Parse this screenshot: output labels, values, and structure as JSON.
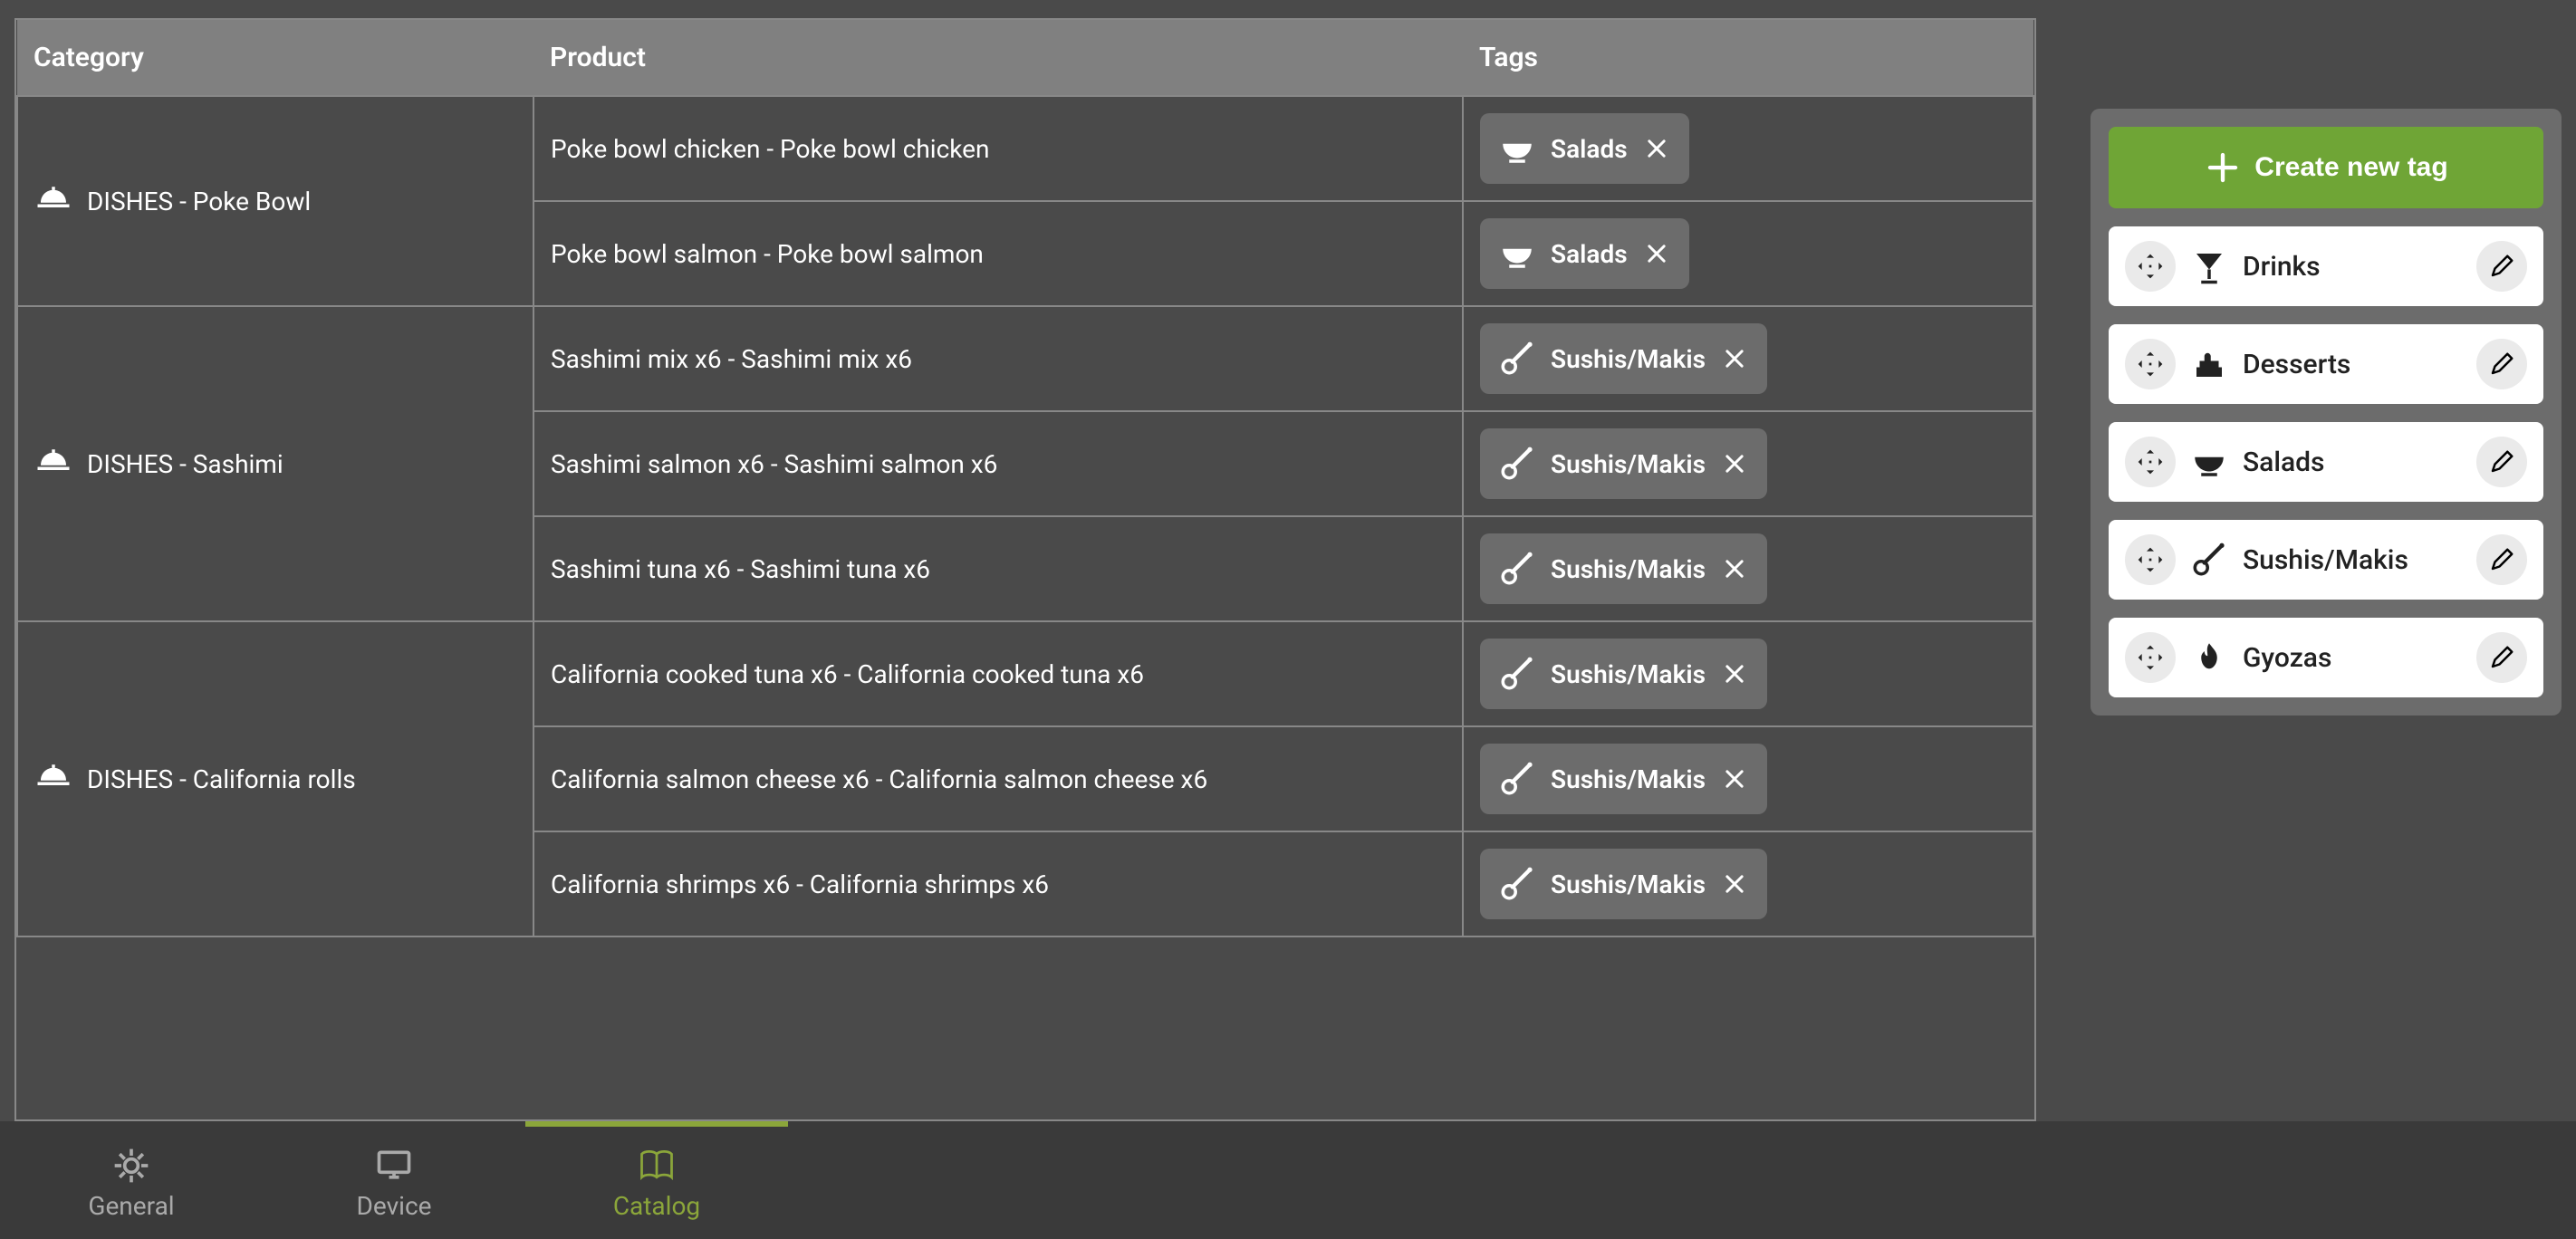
{
  "table": {
    "headers": {
      "category": "Category",
      "product": "Product",
      "tags": "Tags"
    },
    "groups": [
      {
        "category": "DISHES - Poke Bowl",
        "icon": "dish",
        "rows": [
          {
            "product": "Poke bowl chicken - Poke bowl chicken",
            "tag": {
              "label": "Salads",
              "icon": "bowl"
            }
          },
          {
            "product": "Poke bowl salmon - Poke bowl salmon",
            "tag": {
              "label": "Salads",
              "icon": "bowl"
            }
          }
        ]
      },
      {
        "category": "DISHES - Sashimi",
        "icon": "dish",
        "rows": [
          {
            "product": "Sashimi mix x6 - Sashimi mix x6",
            "tag": {
              "label": "Sushis/Makis",
              "icon": "sushi"
            }
          },
          {
            "product": "Sashimi salmon x6 - Sashimi salmon x6",
            "tag": {
              "label": "Sushis/Makis",
              "icon": "sushi"
            }
          },
          {
            "product": "Sashimi tuna x6 - Sashimi tuna x6",
            "tag": {
              "label": "Sushis/Makis",
              "icon": "sushi"
            }
          }
        ]
      },
      {
        "category": "DISHES - California rolls",
        "icon": "dish",
        "rows": [
          {
            "product": "California cooked tuna x6 - California cooked tuna x6",
            "tag": {
              "label": "Sushis/Makis",
              "icon": "sushi"
            }
          },
          {
            "product": "California salmon cheese x6 - California salmon cheese x6",
            "tag": {
              "label": "Sushis/Makis",
              "icon": "sushi"
            }
          },
          {
            "product": "California shrimps x6 - California shrimps x6",
            "tag": {
              "label": "Sushis/Makis",
              "icon": "sushi"
            }
          }
        ]
      }
    ]
  },
  "sidebar": {
    "create_label": "Create new tag",
    "tags": [
      {
        "label": "Drinks",
        "icon": "drink"
      },
      {
        "label": "Desserts",
        "icon": "cake"
      },
      {
        "label": "Salads",
        "icon": "bowl"
      },
      {
        "label": "Sushis/Makis",
        "icon": "sushi"
      },
      {
        "label": "Gyozas",
        "icon": "fire"
      }
    ]
  },
  "nav": {
    "general": "General",
    "device": "Device",
    "catalog": "Catalog"
  }
}
